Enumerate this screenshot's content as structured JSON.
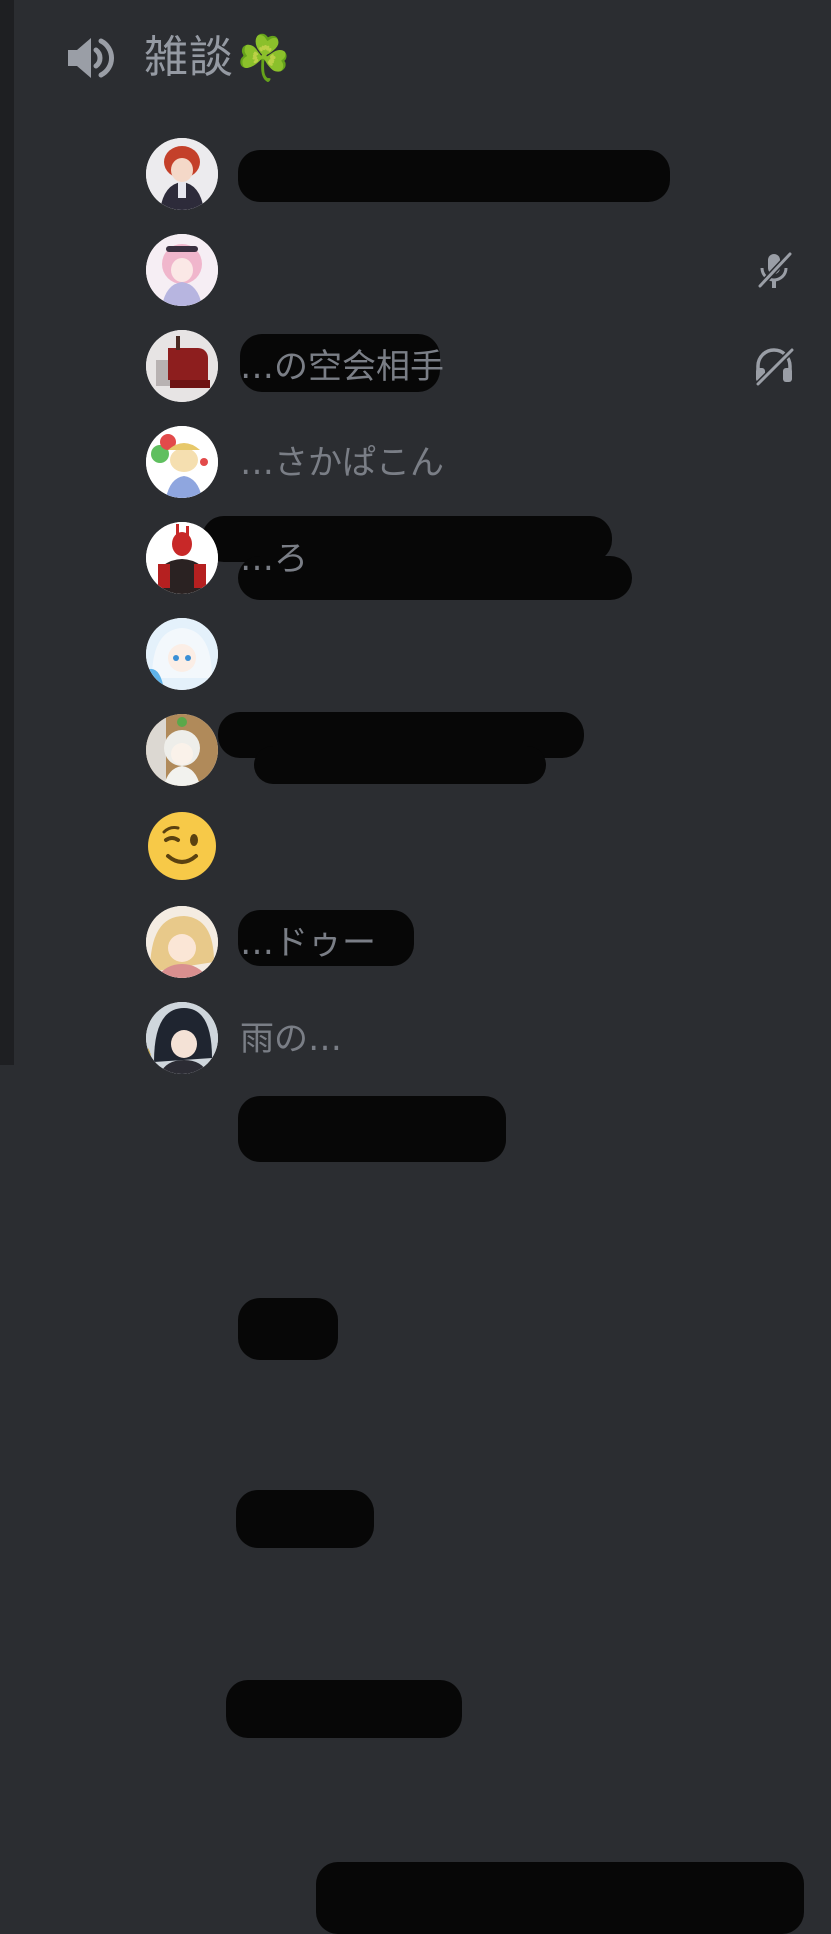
{
  "channel": {
    "name": "雑談",
    "emoji": "☘️"
  },
  "members": [
    {
      "name": "…",
      "avatar": "red-hair-boy-avatar"
    },
    {
      "name": "",
      "avatar": "pink-hair-girl-avatar",
      "status_icon": "mic-muted-icon"
    },
    {
      "name": "…の空会相手",
      "avatar": "red-chair-avatar",
      "status_icon": "deafened-icon"
    },
    {
      "name": "…さかぱこん",
      "avatar": "balloon-character-avatar"
    },
    {
      "name": "…ろ",
      "avatar": "dark-armor-avatar"
    },
    {
      "name": "",
      "avatar": "blue-hair-girl-avatar"
    },
    {
      "name": "",
      "avatar": "white-hair-girl-avatar"
    },
    {
      "name": "",
      "avatar": "winking-emoji-avatar"
    },
    {
      "name": "…ドゥー",
      "avatar": "blonde-girl-avatar"
    },
    {
      "name": "雨の…",
      "avatar": "dark-hair-boy-avatar"
    }
  ],
  "colors": {
    "background": "#2b2d31",
    "text_muted": "#959aa3",
    "redaction": "#070707"
  }
}
